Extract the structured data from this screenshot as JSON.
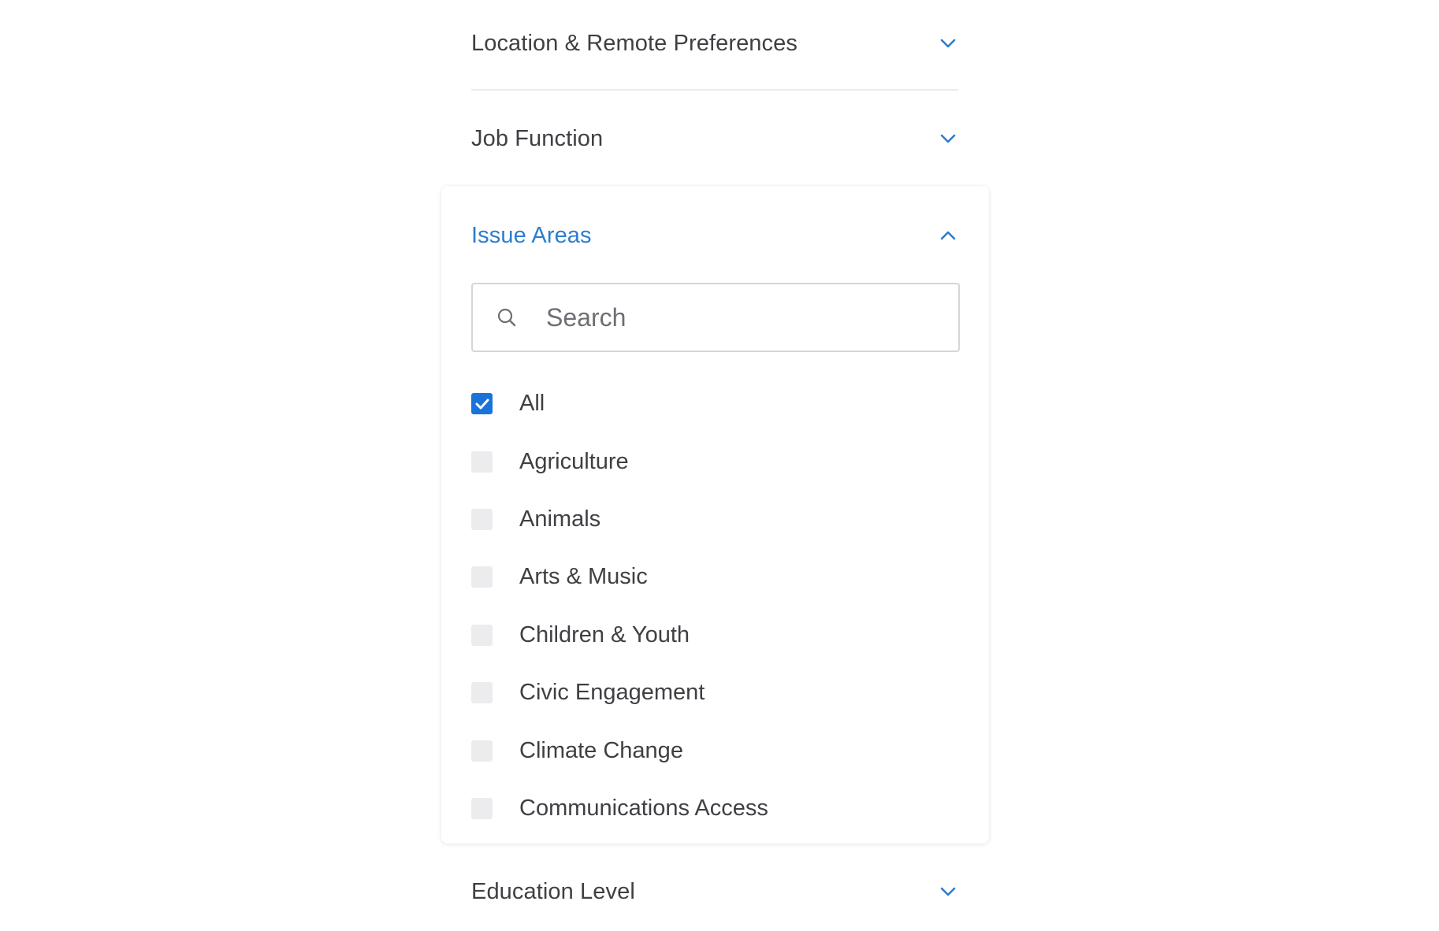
{
  "sections": {
    "location": {
      "title": "Location & Remote Preferences",
      "expanded": false
    },
    "job_function": {
      "title": "Job Function",
      "expanded": false
    },
    "issue_areas": {
      "title": "Issue Areas",
      "expanded": true,
      "search": {
        "placeholder": "Search",
        "value": ""
      },
      "options": [
        {
          "label": "All",
          "checked": true
        },
        {
          "label": "Agriculture",
          "checked": false
        },
        {
          "label": "Animals",
          "checked": false
        },
        {
          "label": "Arts & Music",
          "checked": false
        },
        {
          "label": "Children & Youth",
          "checked": false
        },
        {
          "label": "Civic Engagement",
          "checked": false
        },
        {
          "label": "Climate Change",
          "checked": false
        },
        {
          "label": "Communications Access",
          "checked": false
        }
      ]
    },
    "education_level": {
      "title": "Education Level",
      "expanded": false
    }
  },
  "icons": {
    "collapsed": "chevron-down-icon",
    "expanded": "chevron-up-icon",
    "search": "search-icon",
    "check": "checkmark-icon"
  },
  "colors": {
    "accent": "#2c7dd0",
    "checkbox_checked": "#1a73d9",
    "checkbox_unchecked": "#ececee",
    "text": "#3f3f44",
    "divider": "#ebebed"
  }
}
